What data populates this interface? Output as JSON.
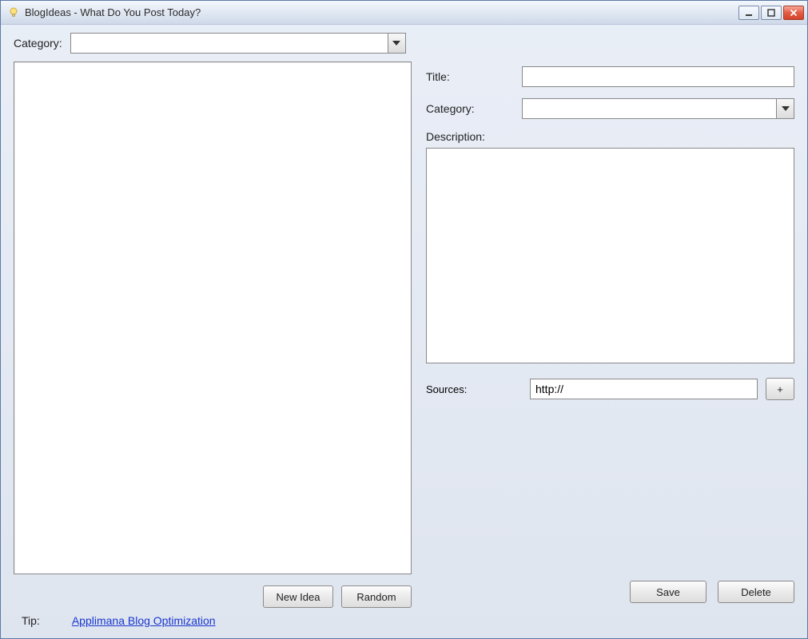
{
  "window": {
    "title": "BlogIdeas - What Do You Post Today?"
  },
  "filter": {
    "label": "Category:",
    "value": ""
  },
  "buttons": {
    "new_idea": "New Idea",
    "random": "Random",
    "save": "Save",
    "delete": "Delete",
    "add_source": "+"
  },
  "form": {
    "title_label": "Title:",
    "title_value": "",
    "category_label": "Category:",
    "category_value": "",
    "description_label": "Description:",
    "description_value": "",
    "sources_label": "Sources:",
    "sources_value": "http://"
  },
  "footer": {
    "tip_label": "Tip:",
    "link_text": "Applimana Blog Optimization"
  }
}
